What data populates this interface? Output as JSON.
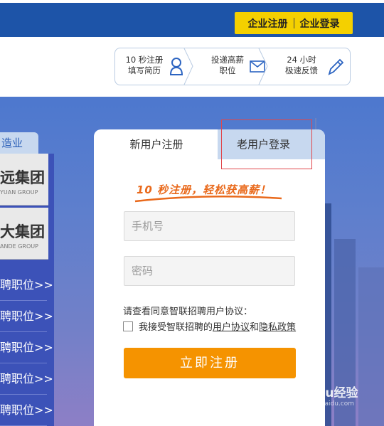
{
  "header": {
    "biz_register": "企业注册",
    "biz_login": "企业登录"
  },
  "steps": [
    {
      "line1": "10 秒注册",
      "line2": "填写简历",
      "icon": "person-icon"
    },
    {
      "line1": "投递高薪",
      "line2": "职位",
      "icon": "envelope-icon"
    },
    {
      "line1": "24 小时",
      "line2": "极速反馈",
      "icon": "pencil-icon"
    }
  ],
  "sidebar": {
    "tab": "造业",
    "logos": [
      {
        "main": "远集团",
        "sub": "YUAN GROUP"
      },
      {
        "main": "大集团",
        "sub": "ANDE GROUP"
      }
    ],
    "links": [
      "聘职位>>",
      "聘职位>>",
      "聘职位>>",
      "聘职位>>",
      "聘职位>>"
    ]
  },
  "form": {
    "tab_new": "新用户注册",
    "tab_old": "老用户登录",
    "slogan": "10 秒注册，轻松获高薪！",
    "phone_placeholder": "手机号",
    "password_placeholder": "密码",
    "agree_note": "请查看同意智联招聘用户协议：",
    "agree_prefix": "我接受智联招聘的",
    "agree_link1": "用户协议",
    "agree_and": "和",
    "agree_link2": "隐私政策",
    "submit": "立即注册"
  },
  "watermark": {
    "main": "Baidu经验",
    "sub": "jingyan.baidu.com"
  },
  "colors": {
    "top_bar": "#1d54a8",
    "biz_button": "#f4d000",
    "register_button": "#f59300",
    "highlight": "#e0474c"
  }
}
